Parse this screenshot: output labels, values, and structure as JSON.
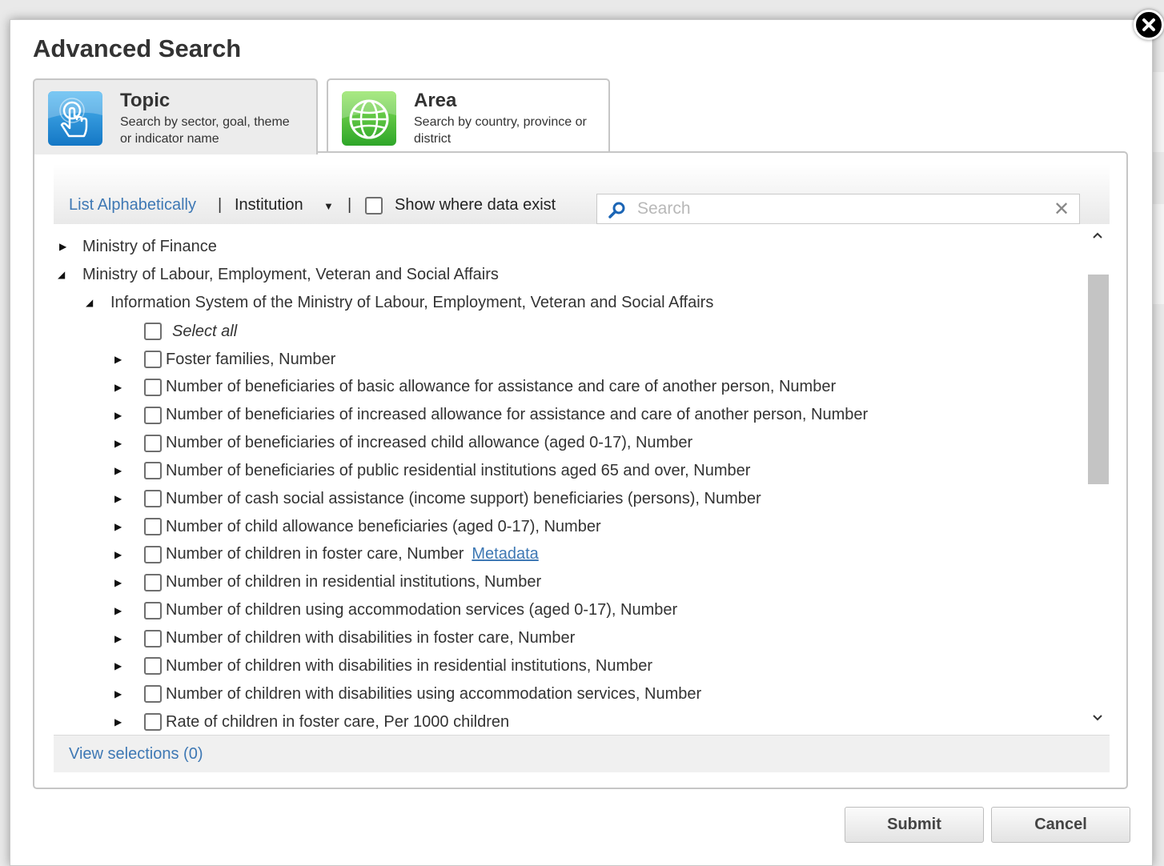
{
  "dialog": {
    "title": "Advanced Search",
    "tabs": [
      {
        "label": "Topic",
        "description": "Search by sector, goal, theme or indicator name",
        "icon": "touch-hand-icon",
        "active": true
      },
      {
        "label": "Area",
        "description": "Search by country, province or district",
        "icon": "globe-icon",
        "active": false
      }
    ]
  },
  "toolbar": {
    "list_alphabetically": "List Alphabetically",
    "separator": "|",
    "institution": "Institution",
    "show_data_label": "Show where data exist",
    "search_placeholder": "Search",
    "search_value": ""
  },
  "tree": {
    "level1": [
      {
        "label": "Ministry of Finance",
        "expanded": false
      },
      {
        "label": "Ministry of Labour, Employment, Veteran and Social Affairs",
        "expanded": true
      }
    ],
    "level2": {
      "label": "Information System of the Ministry of Labour, Employment, Veteran and Social Affairs",
      "expanded": true
    },
    "select_all": "Select all",
    "indicators": [
      "Foster families, Number",
      "Number of beneficiaries of basic allowance for assistance and care of another person, Number",
      "Number of beneficiaries of increased allowance for assistance and care of another person, Number",
      "Number of beneficiaries of increased child allowance (aged 0-17), Number",
      "Number of beneficiaries of public residential institutions aged 65 and over, Number",
      "Number of cash social assistance (income support) beneficiaries (persons), Number",
      "Number of child allowance beneficiaries (aged 0-17), Number",
      "Number of children in foster care, Number",
      "Number of children in residential institutions, Number",
      "Number of children using accommodation services (aged 0-17), Number",
      "Number of children with disabilities in foster care, Number",
      "Number of children with disabilities in residential institutions, Number",
      "Number of children with disabilities using accommodation services, Number",
      "Rate of children in foster care, Per 1000 children"
    ],
    "metadata_link": "Metadata"
  },
  "footer": {
    "view_selections": "View selections (0)",
    "submit": "Submit",
    "cancel": "Cancel"
  },
  "colors": {
    "link": "#3e78b4",
    "topic_icon": "#1e88d6",
    "area_icon": "#3cb534"
  }
}
